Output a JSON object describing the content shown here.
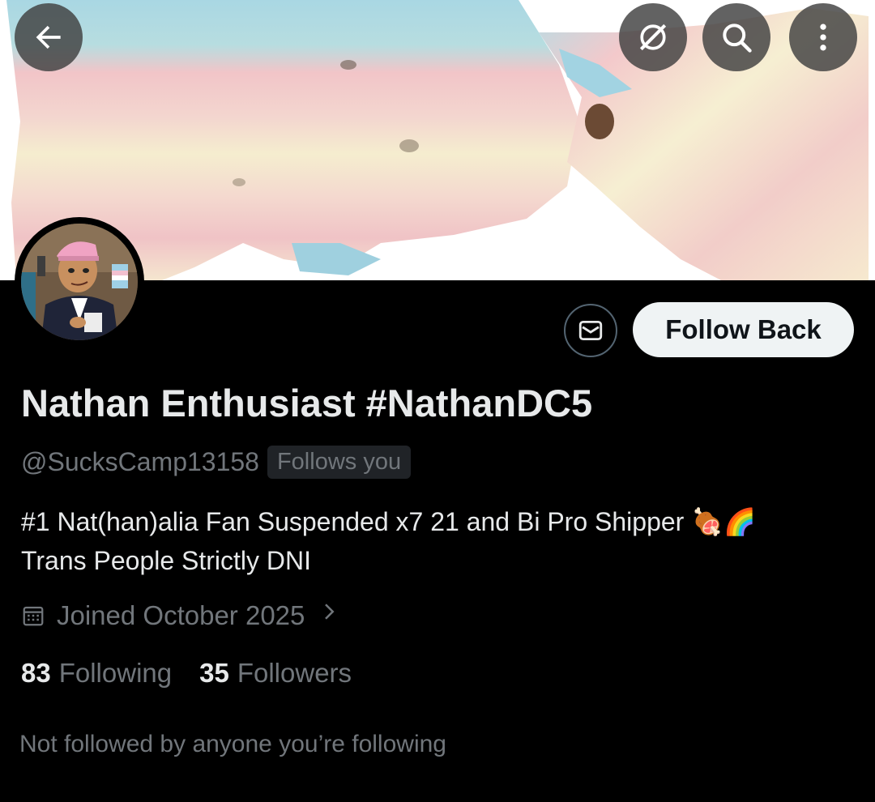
{
  "banner": {
    "alt": ""
  },
  "top_bar": {
    "back_icon": "arrow-left-icon",
    "grok_icon": "grok-icon",
    "search_icon": "search-icon",
    "more_icon": "more-vertical-icon"
  },
  "profile": {
    "name": "Nathan Enthusiast #NathanDC5",
    "handle": "@SucksCamp13158",
    "follows_you_badge": "Follows you",
    "bio_line1": "#1 Nat(han)alia Fan Suspended x7 21 and Bi Pro Shipper 🍖🌈",
    "bio_line2": "Trans People Strictly DNI",
    "joined": "Joined October 2025",
    "following_count": "83",
    "following_label": "Following",
    "followers_count": "35",
    "followers_label": "Followers",
    "mutuals_text": "Not followed by anyone you’re following"
  },
  "actions": {
    "message_icon": "envelope-icon",
    "follow_label": "Follow Back"
  },
  "colors": {
    "background": "#000000",
    "primary_text": "#e7e9ea",
    "secondary_text": "#71767b",
    "button_bg": "#eff3f4",
    "flag_blue": "#a8d8e6",
    "flag_pink": "#f3c2c8",
    "flag_white": "#f4efcf"
  }
}
